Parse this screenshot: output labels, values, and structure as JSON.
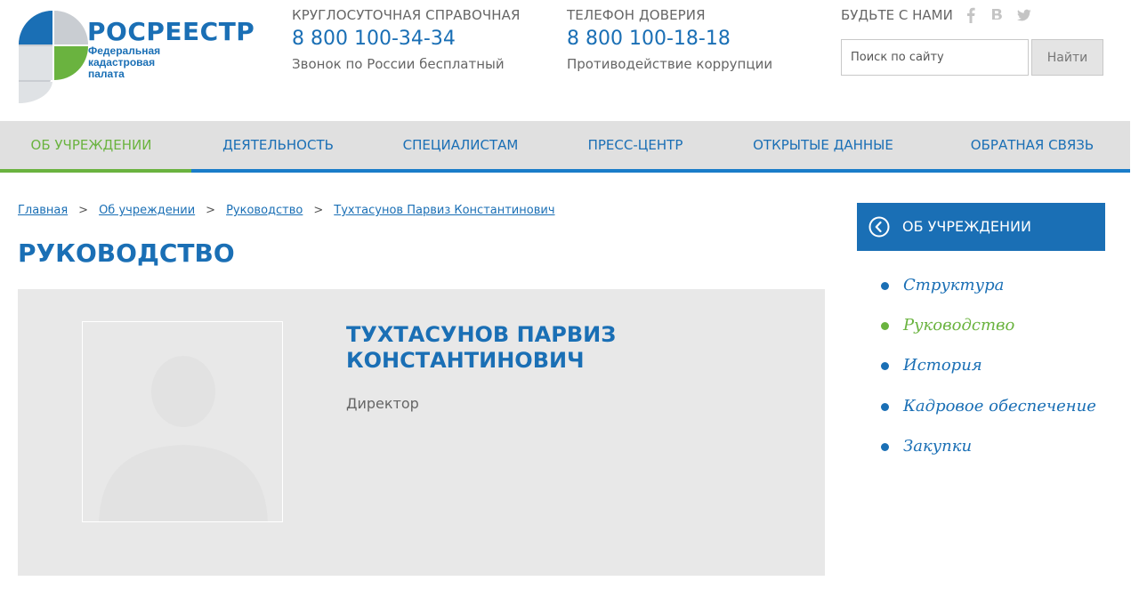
{
  "logo": {
    "title": "РОСРЕЕСТР",
    "subtitle_line1": "Федеральная",
    "subtitle_line2": "кадастровая",
    "subtitle_line3": "палата",
    "colors": {
      "blue": "#1a6fb5",
      "green": "#6ab33f",
      "gray": "#c9c9c9"
    }
  },
  "header": {
    "hotline": {
      "caption": "КРУГЛОСУТОЧНАЯ СПРАВОЧНАЯ",
      "phone": "8 800 100-34-34",
      "note": "Звонок по России бесплатный"
    },
    "trust_line": {
      "caption": "ТЕЛЕФОН ДОВЕРИЯ",
      "phone": "8 800 100-18-18",
      "note": "Противодействие коррупции"
    },
    "social": {
      "caption": "БУДЬТЕ С НАМИ",
      "icons": [
        "facebook-icon",
        "vk-icon",
        "twitter-icon"
      ]
    },
    "search": {
      "placeholder": "Поиск по сайту",
      "value": "",
      "button_label": "Найти"
    }
  },
  "nav": {
    "items": [
      {
        "label": "ОБ УЧРЕЖДЕНИИ",
        "active": true
      },
      {
        "label": "ДЕЯТЕЛЬНОСТЬ",
        "active": false
      },
      {
        "label": "СПЕЦИАЛИСТАМ",
        "active": false
      },
      {
        "label": "ПРЕСС-ЦЕНТР",
        "active": false
      },
      {
        "label": "ОТКРЫТЫЕ ДАННЫЕ",
        "active": false
      },
      {
        "label": "ОБРАТНАЯ СВЯЗЬ",
        "active": false
      }
    ]
  },
  "breadcrumb": {
    "items": [
      "Главная",
      "Об учреждении",
      "Руководство",
      "Тухтасунов Парвиз Константинович"
    ],
    "separator": ">"
  },
  "page": {
    "title": "РУКОВОДСТВО"
  },
  "person": {
    "name_line1": "ТУХТАСУНОВ ПАРВИЗ",
    "name_line2": "КОНСТАНТИНОВИЧ",
    "position": "Директор",
    "photo_icon": "person-silhouette-icon"
  },
  "sidebar": {
    "heading": "ОБ УЧРЕЖДЕНИИ",
    "back_icon": "chevron-left-circle-icon",
    "items": [
      {
        "label": "Структура",
        "active": false
      },
      {
        "label": "Руководство",
        "active": true
      },
      {
        "label": "История",
        "active": false
      },
      {
        "label": "Кадровое обеспечение",
        "active": false
      },
      {
        "label": "Закупки",
        "active": false
      }
    ]
  }
}
